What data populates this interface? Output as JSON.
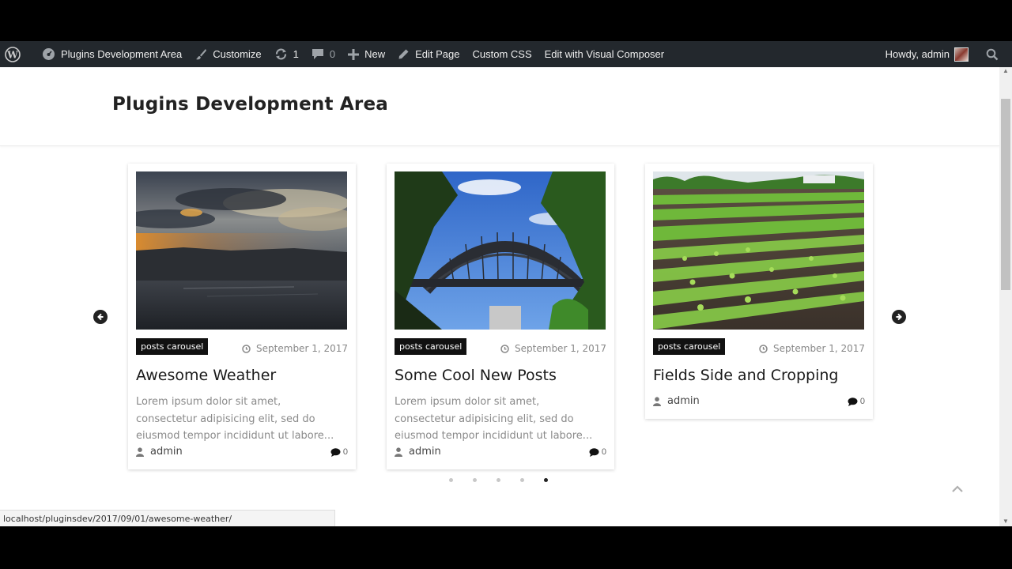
{
  "admin_bar": {
    "site_name": "Plugins Development Area",
    "customize": "Customize",
    "updates_count": "1",
    "comments_count": "0",
    "new_label": "New",
    "edit_page": "Edit Page",
    "custom_css": "Custom CSS",
    "edit_visual_composer": "Edit with Visual Composer",
    "howdy": "Howdy, admin"
  },
  "header": {
    "site_title": "Plugins Development Area"
  },
  "carousel": {
    "cards": [
      {
        "tag": "posts carousel",
        "date": "September 1, 2017",
        "title": "Awesome Weather",
        "excerpt": "Lorem ipsum dolor sit amet, consectetur adipisicing elit, sed do eiusmod tempor incididunt ut labore...",
        "author": "admin",
        "comments": "0",
        "image": "sunset-lake-photo"
      },
      {
        "tag": "posts carousel",
        "date": "September 1, 2017",
        "title": "Some Cool New Posts",
        "excerpt": "Lorem ipsum dolor sit amet, consectetur adipisicing elit, sed do eiusmod tempor incididunt ut labore...",
        "author": "admin",
        "comments": "0",
        "image": "harbour-bridge-photo"
      },
      {
        "tag": "posts carousel",
        "date": "September 1, 2017",
        "title": "Fields Side and Cropping",
        "author": "admin",
        "comments": "0",
        "image": "crop-field-photo"
      }
    ],
    "pagination_dots": 5,
    "active_dot": 5
  },
  "status_url": "localhost/pluginsdev/2017/09/01/awesome-weather/",
  "colors": {
    "admin_bar_bg": "#23282d",
    "tag_bg": "#111111",
    "arrow_bg": "#222222"
  }
}
